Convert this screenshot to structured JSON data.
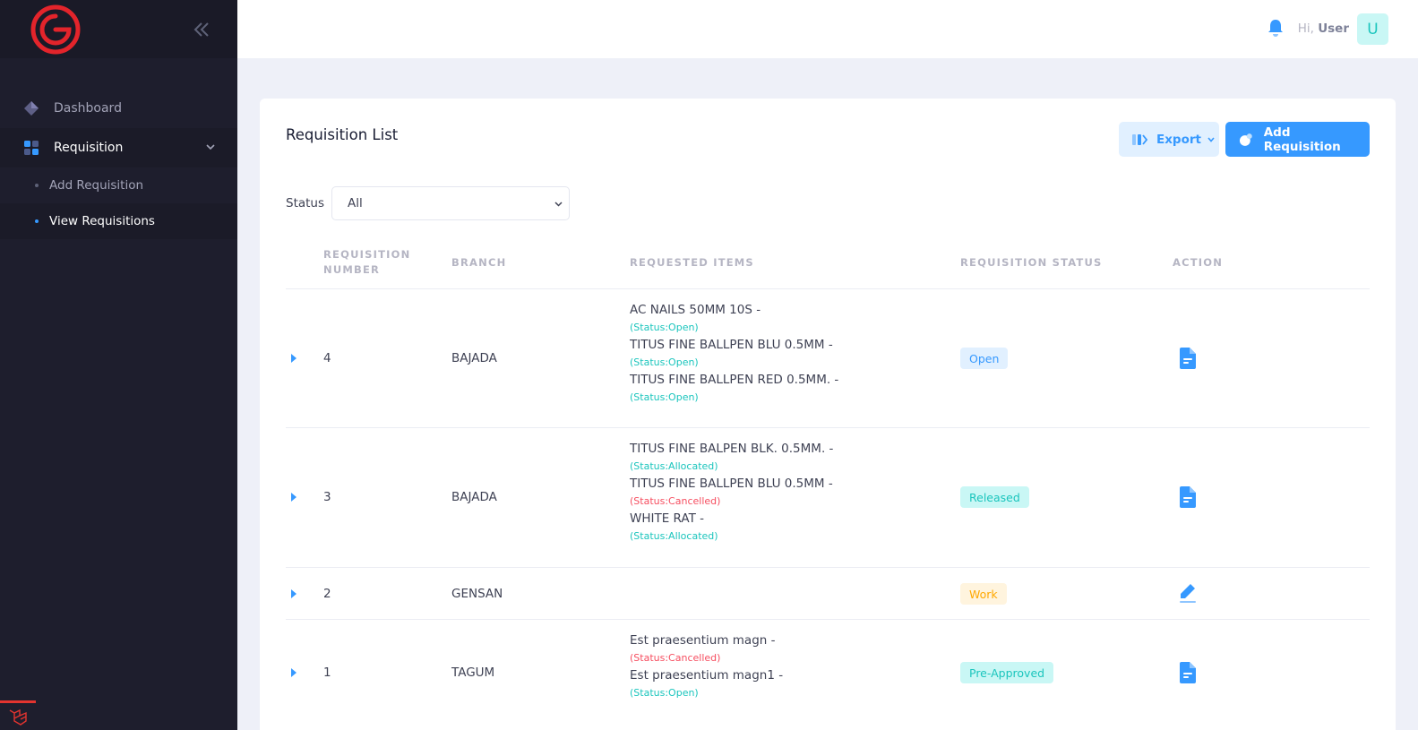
{
  "sidebar": {
    "logo_icon": "brand-g-logo",
    "items": [
      {
        "label": "Dashboard",
        "icon": "diamond-icon"
      },
      {
        "label": "Requisition",
        "icon": "grid-icon"
      }
    ],
    "subitems": [
      {
        "label": "Add Requisition"
      },
      {
        "label": "View Requisitions"
      }
    ]
  },
  "header": {
    "greeting": "Hi,",
    "user_name": "User",
    "avatar_letter": "U"
  },
  "card": {
    "title": "Requisition List",
    "export_label": "Export",
    "add_label": "Add Requisition",
    "status_filter_label": "Status",
    "status_filter_value": "All"
  },
  "table": {
    "columns": [
      "REQUISITION NUMBER",
      "BRANCH",
      "REQUESTED ITEMS",
      "REQUISITION STATUS",
      "ACTION"
    ],
    "rows": [
      {
        "number": "4",
        "branch": "BAJADA",
        "items": [
          {
            "name": "AC NAILS 50MM 10S -",
            "status": "(Status:Open)"
          },
          {
            "name": "TITUS FINE BALLPEN BLU 0.5MM -",
            "status": "(Status:Open)"
          },
          {
            "name": "TITUS FINE BALLPEN RED 0.5MM. -",
            "status": "(Status:Open)"
          }
        ],
        "status": "Open",
        "action_icon": "document-icon"
      },
      {
        "number": "3",
        "branch": "BAJADA",
        "items": [
          {
            "name": "TITUS FINE BALPEN BLK. 0.5MM. -",
            "status": "(Status:Allocated)"
          },
          {
            "name": "TITUS FINE BALLPEN BLU 0.5MM -",
            "status": "(Status:Cancelled)"
          },
          {
            "name": "WHITE RAT -",
            "status": "(Status:Allocated)"
          }
        ],
        "status": "Released",
        "action_icon": "document-icon"
      },
      {
        "number": "2",
        "branch": "GENSAN",
        "items": [],
        "status": "Work",
        "action_icon": "pencil-icon"
      },
      {
        "number": "1",
        "branch": "TAGUM",
        "items": [
          {
            "name": "Est praesentium magn -",
            "status": "(Status:Cancelled)"
          },
          {
            "name": "Est praesentium magn1 -",
            "status": "(Status:Open)"
          }
        ],
        "status": "Pre-Approved",
        "action_icon": "document-icon"
      }
    ]
  },
  "colors": {
    "sidebar_bg": "#1e1e2d",
    "primary": "#3699ff",
    "success": "#1bc5bd",
    "danger": "#f64e60",
    "warning": "#ffa800",
    "brand_red": "#e3242b"
  }
}
